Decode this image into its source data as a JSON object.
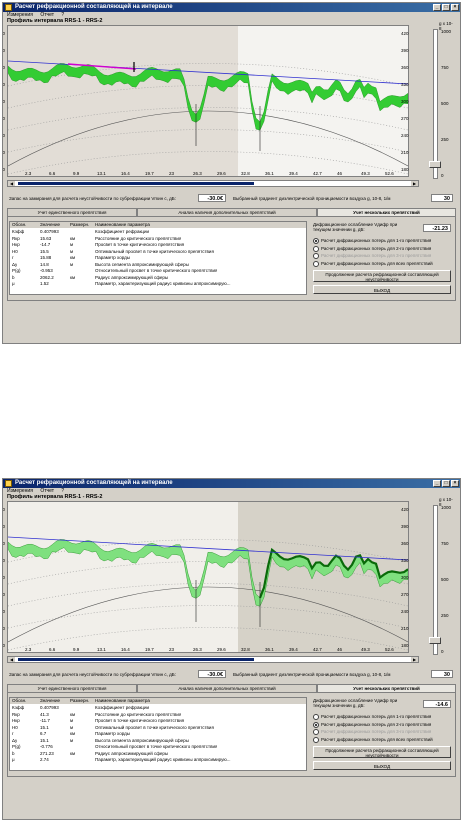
{
  "windows": [
    {
      "title": "Расчет рефракционной составляющей на интервале",
      "menu": [
        "Измерения",
        "Отчет",
        "?"
      ],
      "profile_title": "Профиль интервала  RRS-1 - RRS-2",
      "y_ticks": [
        "420",
        "390",
        "360",
        "330",
        "300",
        "270",
        "240",
        "210",
        "180"
      ],
      "x_ticks": [
        "2.3",
        "6.6",
        "9.9",
        "13.1",
        "16.4",
        "19.7",
        "23",
        "26.3",
        "29.6",
        "32.8",
        "36.1",
        "39.4",
        "42.7",
        "46",
        "49.3",
        "52.6"
      ],
      "scale_label": "g x 10-8",
      "scale_ticks": [
        "1000",
        "750",
        "500",
        "250",
        "0"
      ],
      "reserve_label": "Запас на замирания для расчета неустойчивости по субрефракции Vmин с, дБ:",
      "reserve_value": "-30.0",
      "reserve_unit": "€",
      "gradient_label": "Выбранный градиент диэлектрической проницаемости воздуха g, 10-8, 1/м",
      "gradient_value": "30",
      "tabs": [
        "Учет единственного препятствия",
        "Анализ наличия дополнительных препятствий",
        "Учет нескольких препятствий"
      ],
      "table_headers": [
        "Обозн.",
        "Значение",
        "Размерн.",
        "Наименование параметра"
      ],
      "rows": [
        [
          "Кэфф",
          "0.407993",
          "",
          "Коэффициент рефракции"
        ],
        [
          "Rкр",
          "15.63",
          "км",
          "Расстояние до критического препятствия"
        ],
        [
          "Hкр",
          "-14.7",
          "м",
          "Просвет в точке критического препятствия"
        ],
        [
          "H0",
          "15.5",
          "м",
          "Оптимальный просвет в точке критического препятствия"
        ],
        [
          "r",
          "15.88",
          "км",
          "Параметр хорды"
        ],
        [
          "Δy",
          "14.8",
          "м",
          "Высота сегмента аппроксимирующей сферы"
        ],
        [
          "P(g)",
          "-0.953",
          "",
          "Относительный просвет в точке критического препятствия"
        ],
        [
          "b",
          "2062.2",
          "км",
          "Радиус аппроксимирующей сферы"
        ],
        [
          "μ",
          "1.52",
          "",
          "Параметр, характеризующий радиус кривизны аппроксимирую..."
        ]
      ],
      "attenuation_label": "Дифракционное ослабление Vдифр при текущем значении g, дБ:",
      "attenuation_value": "-21.23",
      "radios": [
        "Расчет дифракционных потерь для 1-го препятствия",
        "Расчет дифракционных потерь для 2-го препятствия",
        "Расчет дифракционных потерь для 3-го препятствия",
        "Расчет дифракционных потерь для всех препятствий"
      ],
      "radio_selected": 0,
      "continue_label": "Продолжение расчета рефракционной составляющей неустойчивости",
      "exit_label": "ВЫХОД"
    },
    {
      "title": "Расчет рефракционной составляющей на интервале",
      "menu": [
        "Измерения",
        "Отчет",
        "?"
      ],
      "profile_title": "Профиль интервала  RRS-1 - RRS-2",
      "y_ticks": [
        "420",
        "390",
        "360",
        "330",
        "300",
        "270",
        "240",
        "210",
        "180"
      ],
      "x_ticks": [
        "2.3",
        "6.6",
        "9.9",
        "13.1",
        "16.4",
        "19.7",
        "23",
        "26.3",
        "29.6",
        "32.8",
        "36.1",
        "39.4",
        "42.7",
        "46",
        "49.3",
        "52.6"
      ],
      "scale_label": "g x 10-8",
      "scale_ticks": [
        "1000",
        "750",
        "500",
        "250",
        "0"
      ],
      "reserve_label": "Запас на замирания для расчета неустойчивости по субрефракции Vmин с, дБ:",
      "reserve_value": "-30.0",
      "reserve_unit": "€",
      "gradient_label": "Выбранный градиент диэлектрической проницаемости воздуха g, 10-8, 1/м",
      "gradient_value": "30",
      "tabs": [
        "Учет единственного препятствия",
        "Анализ наличия дополнительных препятствий",
        "Учет нескольких препятствий"
      ],
      "table_headers": [
        "Обозн.",
        "Значение",
        "Размерн.",
        "Наименование параметра"
      ],
      "rows": [
        [
          "Кэфф",
          "0.407993",
          "",
          "Коэффициент рефракции"
        ],
        [
          "Rкр",
          "41.3",
          "км",
          "Расстояние до критического препятствия"
        ],
        [
          "Hкр",
          "-11.7",
          "м",
          "Просвет в точке критического препятствия"
        ],
        [
          "H0",
          "15.1",
          "м",
          "Оптимальный просвет в точке критического препятствия"
        ],
        [
          "r",
          "6.7",
          "км",
          "Параметр хорды"
        ],
        [
          "Δy",
          "15.1",
          "м",
          "Высота сегмента аппроксимирующей сферы"
        ],
        [
          "P(g)",
          "-0.776",
          "",
          "Относительный просвет в точке критического препятствия"
        ],
        [
          "b",
          "271.23",
          "км",
          "Радиус аппроксимирующей сферы"
        ],
        [
          "μ",
          "2.74",
          "",
          "Параметр, характеризующий радиус кривизны аппроксимирую..."
        ]
      ],
      "attenuation_label": "Дифракционное ослабление Vдифр при текущем значении g, дБ:",
      "attenuation_value": "-14.6",
      "radios": [
        "Расчет дифракционных потерь для 1-го препятствия",
        "Расчет дифракционных потерь для 2-го препятствия",
        "Расчет дифракционных потерь для 3-го препятствия",
        "Расчет дифракционных потерь для всех препятствий"
      ],
      "radio_selected": 1,
      "continue_label": "Продолжение расчета рефракционной составляющей неустойчивости",
      "exit_label": "ВЫХОД"
    }
  ]
}
